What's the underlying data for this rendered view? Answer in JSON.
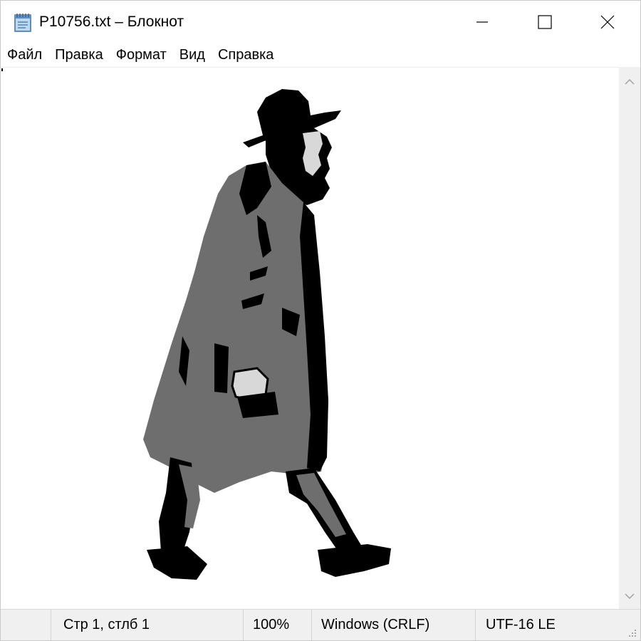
{
  "window": {
    "title": "P10756.txt – Блокнот",
    "buttons": {
      "minimize_icon": "minimize-icon",
      "maximize_icon": "maximize-icon",
      "close_icon": "close-icon"
    }
  },
  "menu": {
    "items": [
      {
        "label": "Файл"
      },
      {
        "label": "Правка"
      },
      {
        "label": "Формат"
      },
      {
        "label": "Вид"
      },
      {
        "label": "Справка"
      }
    ]
  },
  "editor": {
    "content_description_icon": "ascii-art-walking-man-in-hat-and-coat",
    "colors": {
      "dark": "#000000",
      "coat": "#6e6e6e",
      "skin": "#d8d8d8",
      "background": "#ffffff"
    }
  },
  "status": {
    "position": "Стр 1, стлб 1",
    "zoom": "100%",
    "line_endings": "Windows (CRLF)",
    "encoding": "UTF-16 LE"
  },
  "theme": {
    "statusbar_bg": "#f0f0f0",
    "scrollbar_bg": "#f0f0f0",
    "text": "#000000"
  }
}
